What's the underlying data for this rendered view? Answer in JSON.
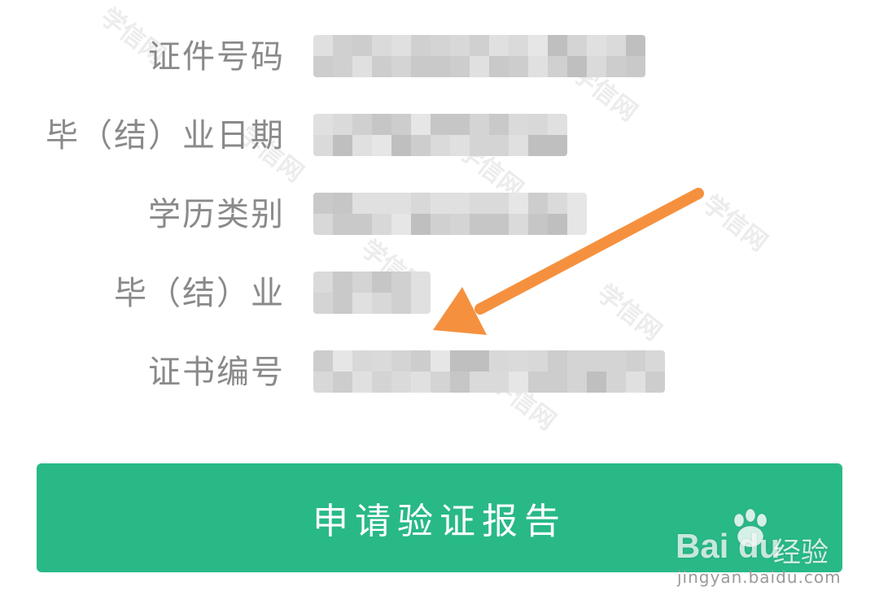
{
  "watermark": {
    "text": "学信网"
  },
  "form": {
    "fields": [
      {
        "label": "证件号码",
        "value_state": "obscured"
      },
      {
        "label": "毕（结）业日期",
        "value_state": "obscured"
      },
      {
        "label": "学历类别",
        "value_state": "obscured"
      },
      {
        "label": "毕（结）业",
        "value_state": "obscured"
      },
      {
        "label": "证书编号",
        "value_state": "obscured"
      }
    ]
  },
  "annotation": {
    "type": "arrow",
    "color": "#f5913e",
    "points_to": "证书编号"
  },
  "actions": {
    "submit_label": "申请验证报告",
    "submit_color": "#28b987"
  },
  "brand": {
    "logo_text": "Bai du",
    "product": "经验",
    "url": "jingyan.baidu.com"
  }
}
